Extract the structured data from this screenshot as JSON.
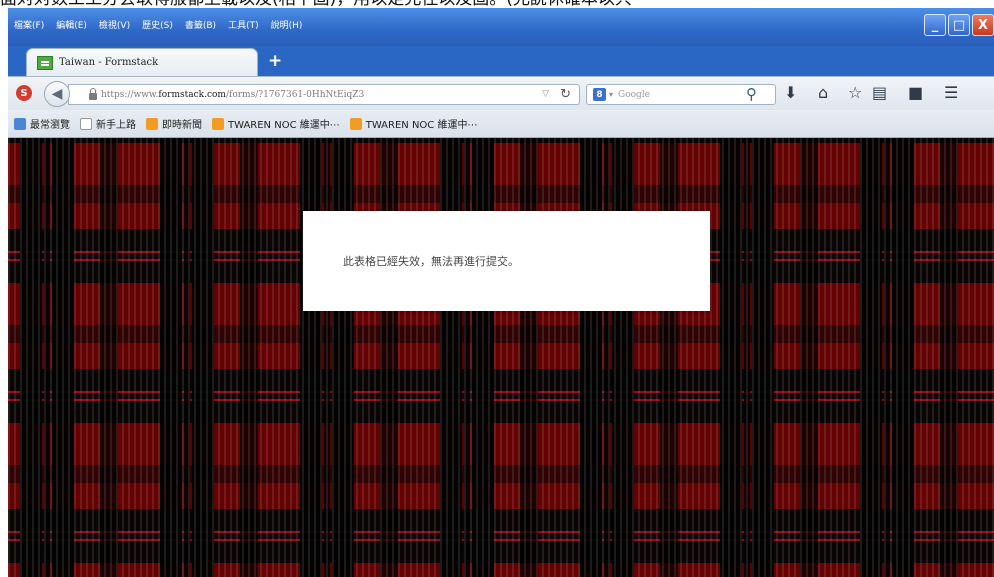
{
  "caption": {
    "text": "面対対数工工分会取得服都上載以及(相下固)，用以足允住以及固。(允説休確本以只"
  },
  "menubar": {
    "items": [
      "檔案(F)",
      "編輯(E)",
      "檢視(V)",
      "歷史(S)",
      "書籤(B)",
      "工具(T)",
      "說明(H)"
    ]
  },
  "window_controls": {
    "minimize": "_",
    "maximize": "□",
    "close": "X"
  },
  "tab": {
    "title": "Taiwan - Formstack",
    "new_tab": "+"
  },
  "navbar": {
    "url_prefix": "https://www.",
    "url_domain": "formstack.com",
    "url_path": "/forms/?1767361-0HhNtEiqZ3",
    "search_engine_badge": "8",
    "search_placeholder": "Google"
  },
  "bookmarks": [
    "最常瀏覽",
    "新手上路",
    "即時新聞",
    "TWAREN NOC 維運中⋯",
    "TWAREN NOC 維運中⋯"
  ],
  "dialog": {
    "message": "此表格已經失效，無法再進行提交。"
  },
  "colors": {
    "tartan_red": "#a00d17",
    "tartan_green": "#0f5b2c",
    "tartan_blue": "#27377c",
    "titlebar": "#2e68c8"
  },
  "icons": [
    "stop-icon",
    "back-icon",
    "lock-icon",
    "reload-icon",
    "google-icon",
    "search-icon",
    "download-icon",
    "home-icon",
    "star-icon",
    "reading-list-icon",
    "pocket-icon",
    "menu-icon"
  ]
}
